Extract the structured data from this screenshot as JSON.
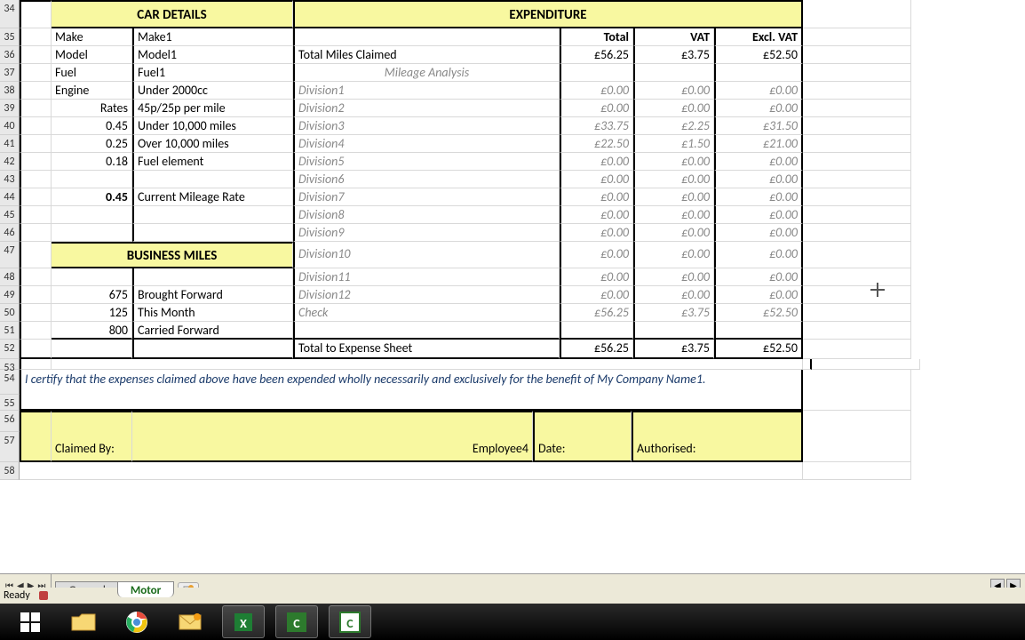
{
  "rowHeaders": [
    "34",
    "35",
    "36",
    "37",
    "38",
    "39",
    "40",
    "41",
    "42",
    "43",
    "44",
    "45",
    "46",
    "47",
    "48",
    "49",
    "50",
    "51",
    "52",
    "53",
    "54",
    "55",
    "56",
    "57",
    "58"
  ],
  "headers": {
    "carDetails": "CAR DETAILS",
    "expenditure": "EXPENDITURE",
    "businessMiles": "BUSINESS MILES"
  },
  "car": {
    "makeLabel": "Make",
    "make": "Make1",
    "modelLabel": "Model",
    "model": "Model1",
    "fuelLabel": "Fuel",
    "fuel": "Fuel1",
    "engineLabel": "Engine",
    "engine": "Under 2000cc",
    "ratesLabel": "Rates",
    "rates": "45p/25p per mile",
    "r1v": "0.45",
    "r1l": "Under 10,000 miles",
    "r2v": "0.25",
    "r2l": "Over 10,000 miles",
    "r3v": "0.18",
    "r3l": "Fuel element",
    "curv": "0.45",
    "curl": "Current Mileage Rate"
  },
  "exp": {
    "totalH": "Total",
    "vatH": "VAT",
    "exvatH": "Excl. VAT",
    "totalMilesLabel": "Total Miles Claimed",
    "totalMiles": {
      "t": "£56.25",
      "v": "£3.75",
      "e": "£52.50"
    },
    "mileageAnalysis": "Mileage Analysis",
    "divisions": [
      {
        "name": "Division1",
        "t": "£0.00",
        "v": "£0.00",
        "e": "£0.00"
      },
      {
        "name": "Division2",
        "t": "£0.00",
        "v": "£0.00",
        "e": "£0.00"
      },
      {
        "name": "Division3",
        "t": "£33.75",
        "v": "£2.25",
        "e": "£31.50"
      },
      {
        "name": "Division4",
        "t": "£22.50",
        "v": "£1.50",
        "e": "£21.00"
      },
      {
        "name": "Division5",
        "t": "£0.00",
        "v": "£0.00",
        "e": "£0.00"
      },
      {
        "name": "Division6",
        "t": "£0.00",
        "v": "£0.00",
        "e": "£0.00"
      },
      {
        "name": "Division7",
        "t": "£0.00",
        "v": "£0.00",
        "e": "£0.00"
      },
      {
        "name": "Division8",
        "t": "£0.00",
        "v": "£0.00",
        "e": "£0.00"
      },
      {
        "name": "Division9",
        "t": "£0.00",
        "v": "£0.00",
        "e": "£0.00"
      },
      {
        "name": "Division10",
        "t": "£0.00",
        "v": "£0.00",
        "e": "£0.00"
      },
      {
        "name": "Division11",
        "t": "£0.00",
        "v": "£0.00",
        "e": "£0.00"
      },
      {
        "name": "Division12",
        "t": "£0.00",
        "v": "£0.00",
        "e": "£0.00"
      }
    ],
    "checkLabel": "Check",
    "check": {
      "t": "£56.25",
      "v": "£3.75",
      "e": "£52.50"
    },
    "totalToExpense": "Total to Expense Sheet",
    "grand": {
      "t": "£56.25",
      "v": "£3.75",
      "e": "£52.50"
    }
  },
  "miles": {
    "bfv": "675",
    "bfl": "Brought Forward",
    "tmv": "125",
    "tml": "This Month",
    "cfv": "800",
    "cfl": "Carried Forward"
  },
  "cert": "I certify that the expenses claimed above have been expended wholly necessarily and exclusively for the benefit of My Company Name1.",
  "sig": {
    "claimedBy": "Claimed By:",
    "employee": "Employee4",
    "date": "Date:",
    "authorised": "Authorised:"
  },
  "tabs": {
    "general": "General",
    "motor": "Motor"
  },
  "status": {
    "ready": "Ready"
  }
}
